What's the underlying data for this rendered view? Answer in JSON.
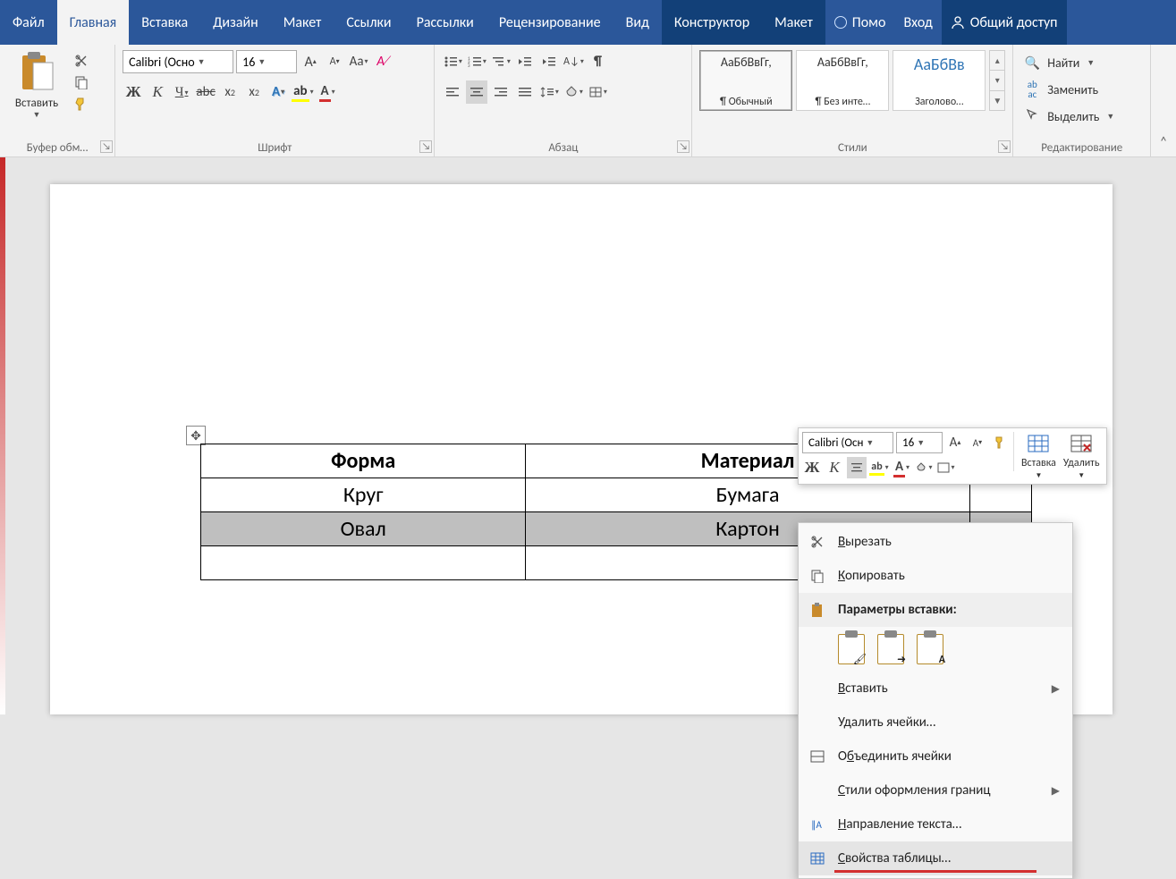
{
  "tabs": {
    "file": "Файл",
    "home": "Главная",
    "insert": "Вставка",
    "design": "Дизайн",
    "layout": "Макет",
    "references": "Ссылки",
    "mailings": "Рассылки",
    "review": "Рецензирование",
    "view": "Вид",
    "table_design": "Конструктор",
    "table_layout": "Макет",
    "tellme": "Помо",
    "signin": "Вход",
    "share": "Общий доступ"
  },
  "ribbon": {
    "clipboard": {
      "label": "Буфер обм…",
      "paste": "Вставить"
    },
    "font": {
      "label": "Шрифт",
      "name": "Calibri (Осно",
      "size": "16",
      "bold": "Ж",
      "italic": "К",
      "underline": "Ч",
      "strike": "abc",
      "sub": "x",
      "sub2": "2",
      "sup": "x",
      "sup2": "2",
      "aa": "Aa",
      "bigA": "A",
      "smallA": "A",
      "clear": "A"
    },
    "paragraph": {
      "label": "Абзац"
    },
    "styles": {
      "label": "Стили",
      "items": [
        {
          "sample": "АаБбВвГг,",
          "name": "¶ Обычный",
          "selected": true
        },
        {
          "sample": "АаБбВвГг,",
          "name": "¶ Без инте…",
          "selected": false
        },
        {
          "sample": "АаБбВв",
          "name": "Заголово…",
          "selected": false,
          "color": "#2e74b5"
        }
      ]
    },
    "editing": {
      "label": "Редактирование",
      "find": "Найти",
      "replace": "Заменить",
      "select": "Выделить"
    }
  },
  "document": {
    "headers": [
      "Форма",
      "Материал"
    ],
    "rows": [
      [
        "Круг",
        "Бумага"
      ],
      [
        "Овал",
        "Картон"
      ],
      [
        "",
        ""
      ]
    ],
    "selected_row_index": 1
  },
  "minitoolbar": {
    "font": "Calibri (Осн",
    "size": "16",
    "bold": "Ж",
    "italic": "К",
    "bigA": "A",
    "smallA": "A",
    "insert": "Вставка",
    "delete": "Удалить"
  },
  "contextmenu": {
    "cut": "Вырезать",
    "copy": "Копировать",
    "paste_options": "Параметры вставки:",
    "insert": "Вставить",
    "delete_cells": "Удалить ячейки…",
    "merge_cells": "Объединить ячейки",
    "border_styles": "Стили оформления границ",
    "text_direction": "Направление текста…",
    "table_properties": "Свойства таблицы…"
  }
}
